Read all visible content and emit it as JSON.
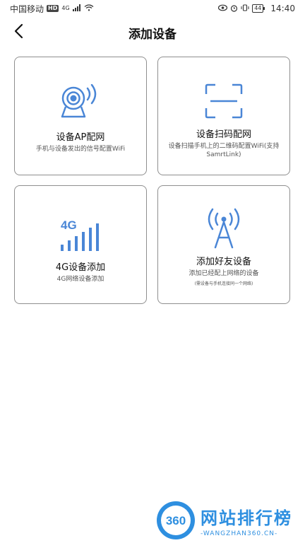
{
  "status_bar": {
    "carrier": "中国移动",
    "hd": "HD",
    "network": "4G",
    "battery": "44",
    "time": "14:40"
  },
  "header": {
    "title": "添加设备"
  },
  "cards": [
    {
      "title": "设备AP配网",
      "desc": "手机与设备发出的信号配置WiFi",
      "icon": "webcam-wifi-icon"
    },
    {
      "title": "设备扫码配网",
      "desc": "设备扫描手机上的二维码配置WiFi(支持SamrtLink)",
      "icon": "scan-frame-icon"
    },
    {
      "title": "4G设备添加",
      "desc": "4G网络设备添加",
      "icon": "4g-signal-icon"
    },
    {
      "title": "添加好友设备",
      "desc": "添加已经配上网络的设备",
      "note": "(需设备与手机连接同一个网络)",
      "icon": "antenna-tower-icon"
    }
  ],
  "watermark": {
    "badge": "360",
    "title": "网站排行榜",
    "subtitle": "-WANGZHAN360.CN-"
  },
  "colors": {
    "accent": "#4a86d6",
    "card_border": "#8f8f8f",
    "watermark": "#2e8fe0"
  }
}
